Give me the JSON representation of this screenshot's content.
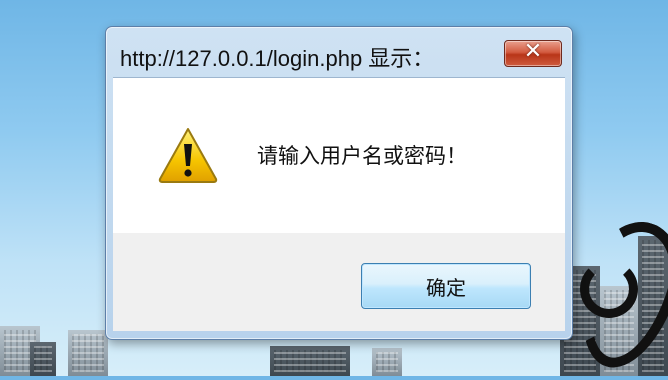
{
  "dialog": {
    "title": "http://127.0.0.1/login.php 显示：",
    "close_label": "✕",
    "message": "请输入用户名或密码！",
    "ok_label": "确定",
    "icon": "warning-icon"
  },
  "colors": {
    "title_bar": "#c2d9ef",
    "close_button": "#c9472a",
    "ok_button_border": "#3c7fb1",
    "warning_yellow": "#f6c400"
  }
}
